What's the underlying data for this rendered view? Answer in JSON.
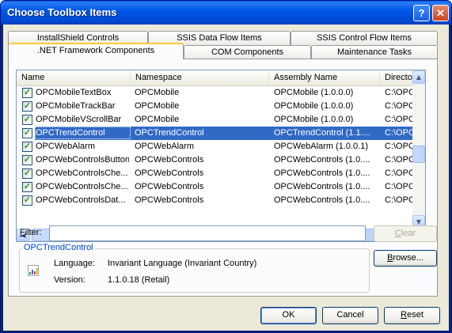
{
  "window": {
    "title": "Choose Toolbox Items",
    "help_label": "?",
    "close_label": "✕"
  },
  "tabs_back": [
    "InstallShield Controls",
    "SSIS Data Flow Items",
    "SSIS Control Flow Items"
  ],
  "tabs_front": [
    ".NET Framework Components",
    "COM Components",
    "Maintenance Tasks"
  ],
  "list": {
    "columns": [
      "Name",
      "Namespace",
      "Assembly Name",
      "Directory"
    ],
    "rows": [
      {
        "name": "OPCMobileTextBox",
        "namespace": "OPCMobile",
        "assembly": "OPCMobile (1.0.0.0)",
        "directory": "C:\\OPCSy",
        "checked": true,
        "selected": false
      },
      {
        "name": "OPCMobileTrackBar",
        "namespace": "OPCMobile",
        "assembly": "OPCMobile (1.0.0.0)",
        "directory": "C:\\OPCSy",
        "checked": true,
        "selected": false
      },
      {
        "name": "OPCMobileVScrollBar",
        "namespace": "OPCMobile",
        "assembly": "OPCMobile (1.0.0.0)",
        "directory": "C:\\OPCSy",
        "checked": true,
        "selected": false
      },
      {
        "name": "OPCTrendControl",
        "namespace": "OPCTrendControl",
        "assembly": "OPCTrendControl (1.1....",
        "directory": "C:\\OPCSy",
        "checked": true,
        "selected": true
      },
      {
        "name": "OPCWebAlarm",
        "namespace": "OPCWebAlarm",
        "assembly": "OPCWebAlarm (1.0.0.1)",
        "directory": "C:\\OPCSy",
        "checked": true,
        "selected": false
      },
      {
        "name": "OPCWebControlsButton",
        "namespace": "OPCWebControls",
        "assembly": "OPCWebControls (1.0....",
        "directory": "C:\\OPCSy",
        "checked": true,
        "selected": false
      },
      {
        "name": "OPCWebControlsChe...",
        "namespace": "OPCWebControls",
        "assembly": "OPCWebControls (1.0....",
        "directory": "C:\\OPCSy",
        "checked": true,
        "selected": false
      },
      {
        "name": "OPCWebControlsChe...",
        "namespace": "OPCWebControls",
        "assembly": "OPCWebControls (1.0....",
        "directory": "C:\\OPCSy",
        "checked": true,
        "selected": false
      },
      {
        "name": "OPCWebControlsDat...",
        "namespace": "OPCWebControls",
        "assembly": "OPCWebControls (1.0....",
        "directory": "C:\\OPCSy",
        "checked": true,
        "selected": false
      }
    ]
  },
  "filter": {
    "label_u": "F",
    "label_rest": "ilter:",
    "value": "",
    "clear_u": "C",
    "clear_rest": "lear"
  },
  "details": {
    "group_title": "OPCTrendControl",
    "language_label": "Language:",
    "language_value": "Invariant Language (Invariant Country)",
    "version_label": "Version:",
    "version_value": "1.1.0.18 (Retail)"
  },
  "buttons": {
    "browse_u": "B",
    "browse_rest": "rowse...",
    "ok": "OK",
    "cancel": "Cancel",
    "reset_u": "R",
    "reset_rest": "eset"
  },
  "colors": {
    "selection": "#316ac5",
    "title_bar": "#0058e6",
    "group_title": "#0046d5"
  }
}
